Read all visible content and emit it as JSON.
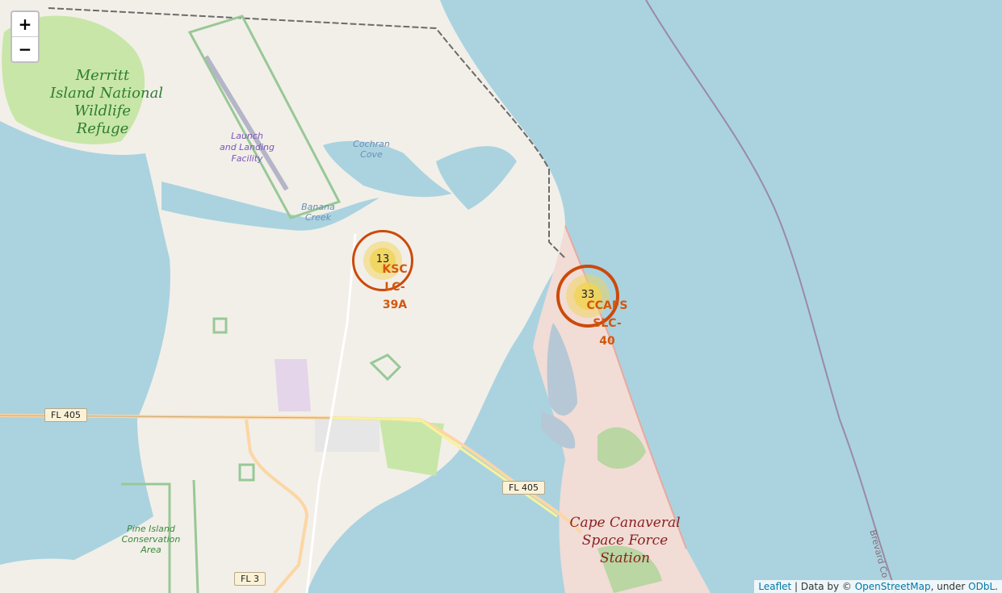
{
  "labels": {
    "merritt": [
      "Merritt",
      "Island National",
      "Wildlife",
      "Refuge"
    ],
    "launch_facility": [
      "Launch",
      "and Landing",
      "Facility"
    ],
    "cochran": [
      "Cochran",
      "Cove"
    ],
    "banana": [
      "Banana",
      "Creek"
    ],
    "pine_island": [
      "Pine Island",
      "Conservation",
      "Area"
    ],
    "cape": [
      "Cape Canaveral",
      "Space Force",
      "Station"
    ],
    "brevard": "Brevard Co"
  },
  "roads": {
    "fl405_west": "FL 405",
    "fl405_east": "FL 405",
    "fl3": "FL 3"
  },
  "clusters": [
    {
      "count": "13",
      "label_lines": [
        "KSC",
        "LC-",
        "39A"
      ]
    },
    {
      "count": "33",
      "label_lines": [
        "CCAFS",
        "SLC-",
        "40"
      ]
    }
  ],
  "zoom": {
    "in": "+",
    "out": "−"
  },
  "attribution": {
    "leaflet": "Leaflet",
    "sep": " | Data by © ",
    "osm": "OpenStreetMap",
    "under": ", under ",
    "odbl": "ODbL",
    "end": "."
  }
}
